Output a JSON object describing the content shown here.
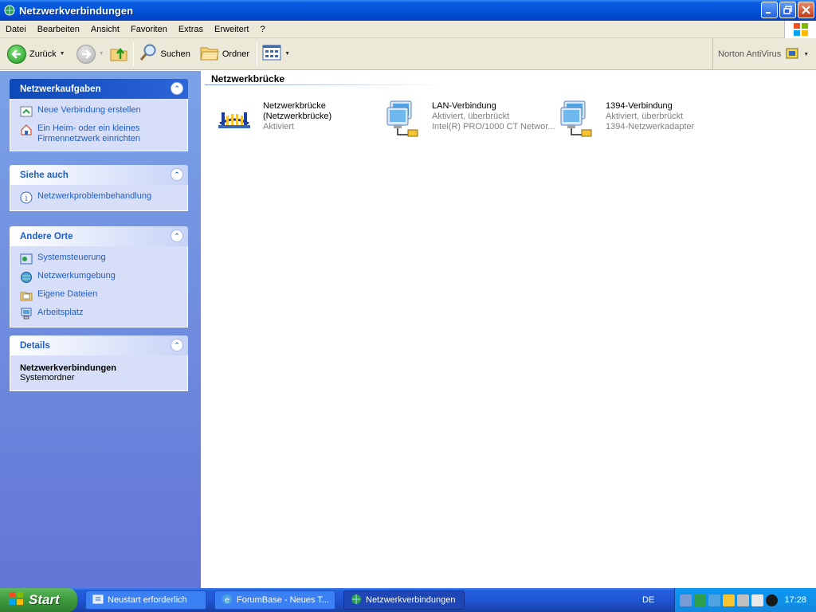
{
  "window": {
    "title": "Netzwerkverbindungen"
  },
  "menu": [
    "Datei",
    "Bearbeiten",
    "Ansicht",
    "Favoriten",
    "Extras",
    "Erweitert",
    "?"
  ],
  "toolbar": {
    "back_label": "Zurück",
    "search_label": "Suchen",
    "folders_label": "Ordner",
    "norton_label": "Norton AntiVirus"
  },
  "sidebar": {
    "tasks": {
      "title": "Netzwerkaufgaben",
      "items": [
        "Neue Verbindung erstellen",
        "Ein Heim- oder ein kleines Firmennetzwerk einrichten"
      ]
    },
    "see_also": {
      "title": "Siehe auch",
      "items": [
        "Netzwerkproblembehandlung"
      ]
    },
    "other_places": {
      "title": "Andere Orte",
      "items": [
        "Systemsteuerung",
        "Netzwerkumgebung",
        "Eigene Dateien",
        "Arbeitsplatz"
      ]
    },
    "details": {
      "title": "Details",
      "name": "Netzwerkverbindungen",
      "type": "Systemordner"
    }
  },
  "content": {
    "group": "Netzwerkbrücke",
    "items": [
      {
        "line1": "Netzwerkbrücke",
        "line2": "(Netzwerkbrücke)",
        "line3": "Aktiviert"
      },
      {
        "line1": "LAN-Verbindung",
        "line2": "Aktiviert, überbrückt",
        "line3": "Intel(R) PRO/1000 CT Networ..."
      },
      {
        "line1": "1394-Verbindung",
        "line2": "Aktiviert, überbrückt",
        "line3": "1394-Netzwerkadapter"
      }
    ]
  },
  "taskbar": {
    "start": "Start",
    "items": [
      "Neustart erforderlich",
      "ForumBase - Neues T...",
      "Netzwerkverbindungen"
    ],
    "lang": "DE",
    "clock": "17:28"
  }
}
